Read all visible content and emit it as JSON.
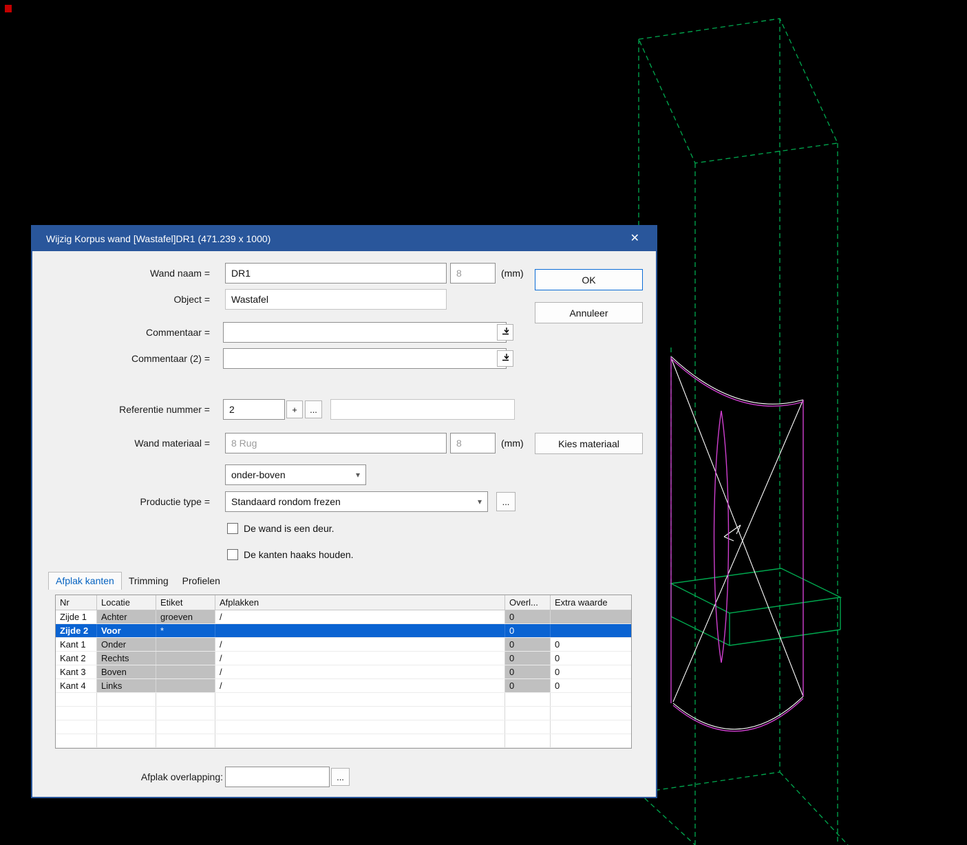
{
  "dialog": {
    "title": "Wijzig Korpus wand [Wastafel]DR1 (471.239 x 1000)",
    "labels": {
      "wand_naam": "Wand naam =",
      "object": "Object =",
      "commentaar": "Commentaar =",
      "commentaar2": "Commentaar (2) =",
      "referentie_nummer": "Referentie nummer =",
      "wand_materiaal": "Wand materiaal =",
      "productie_type": "Productie type =",
      "mm": "(mm)",
      "afplak_overlapping": "Afplak overlapping:"
    },
    "values": {
      "wand_naam": "DR1",
      "wand_dikte": "8",
      "object": "Wastafel",
      "commentaar": "",
      "commentaar2": "",
      "referentie_nummer": "2",
      "referentie_extra": "",
      "wand_materiaal": "8 Rug",
      "materiaal_dikte": "8",
      "richting": "onder-boven",
      "productie_type": "Standaard rondom frezen",
      "afplak_overlapping": ""
    },
    "checkboxes": [
      {
        "label": "De wand is een deur.",
        "checked": false
      },
      {
        "label": "De kanten haaks houden.",
        "checked": false
      }
    ],
    "buttons": {
      "ok": "OK",
      "annuleer": "Annuleer",
      "kies_materiaal": "Kies materiaal",
      "plus": "+",
      "dots": "..."
    },
    "tabs": [
      {
        "label": "Afplak kanten",
        "active": true
      },
      {
        "label": "Trimming",
        "active": false
      },
      {
        "label": "Profielen",
        "active": false
      }
    ],
    "table": {
      "headers": [
        "Nr",
        "Locatie",
        "Etiket",
        "Afplakken",
        "Overl...",
        "Extra waarde"
      ],
      "rows": [
        {
          "nr": "Zijde 1",
          "locatie": "Achter",
          "etiket": "groeven",
          "afplakken": "/",
          "overl": "0",
          "extra": ""
        },
        {
          "nr": "Zijde 2",
          "locatie": "Voor",
          "etiket": "*",
          "afplakken": "",
          "overl": "0",
          "extra": ""
        },
        {
          "nr": "Kant 1",
          "locatie": "Onder",
          "etiket": "",
          "afplakken": "/",
          "overl": "0",
          "extra": "0"
        },
        {
          "nr": "Kant 2",
          "locatie": "Rechts",
          "etiket": "",
          "afplakken": "/",
          "overl": "0",
          "extra": "0"
        },
        {
          "nr": "Kant 3",
          "locatie": "Boven",
          "etiket": "",
          "afplakken": "/",
          "overl": "0",
          "extra": "0"
        },
        {
          "nr": "Kant 4",
          "locatie": "Links",
          "etiket": "",
          "afplakken": "/",
          "overl": "0",
          "extra": "0"
        }
      ]
    },
    "icons": {
      "close": "✕",
      "dropdown_arrow": "▾"
    }
  },
  "colors": {
    "titlebar": "#29569b",
    "selection": "#0a63d2",
    "wire_green": "#00a94f",
    "wire_magenta": "#cf3fcf"
  }
}
